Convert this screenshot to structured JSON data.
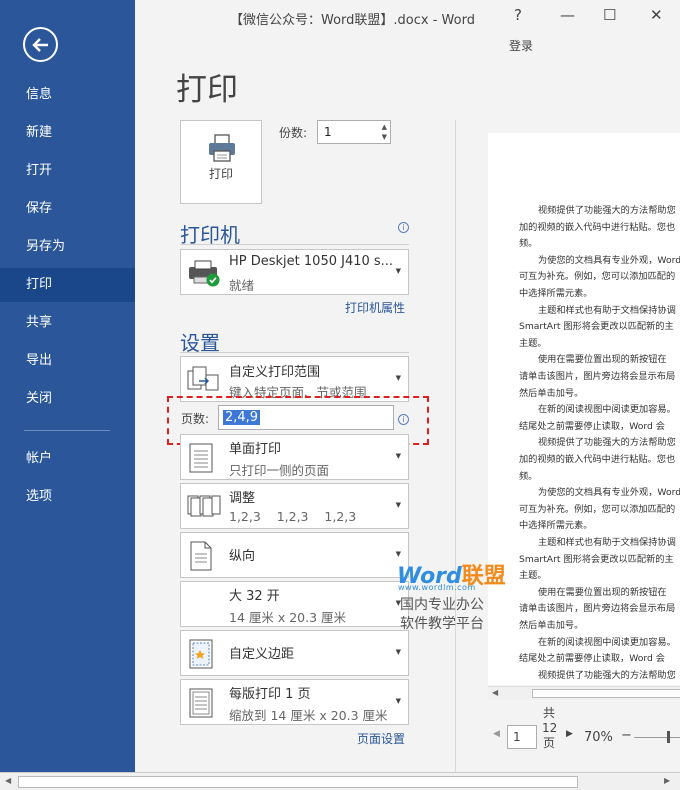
{
  "window": {
    "title": "【微信公众号：Word联盟】.docx - Word",
    "help": "?",
    "minimize": "—",
    "restore": "☐",
    "close": "✕",
    "login": "登录"
  },
  "sidebar": {
    "items": [
      {
        "label": "信息"
      },
      {
        "label": "新建"
      },
      {
        "label": "打开"
      },
      {
        "label": "保存"
      },
      {
        "label": "另存为"
      },
      {
        "label": "打印"
      },
      {
        "label": "共享"
      },
      {
        "label": "导出"
      },
      {
        "label": "关闭"
      },
      {
        "label": "帐户"
      },
      {
        "label": "选项"
      }
    ],
    "active": "打印"
  },
  "print": {
    "title": "打印",
    "button_label": "打印",
    "copies_label": "份数:",
    "copies_value": "1"
  },
  "printer": {
    "heading": "打印机",
    "name": "HP Deskjet 1050 J410 s...",
    "status": "就绪",
    "properties_link": "打印机属性"
  },
  "settings": {
    "heading": "设置",
    "range": {
      "title": "自定义打印范围",
      "sub": "键入特定页面、节或范围"
    },
    "pages_label": "页数:",
    "pages_value": "2,4,9",
    "sides": {
      "title": "单面打印",
      "sub": "只打印一侧的页面"
    },
    "collate": {
      "title": "调整",
      "sub": "1,2,3    1,2,3    1,2,3"
    },
    "orientation": {
      "title": "纵向"
    },
    "paper": {
      "title": "大 32 开",
      "sub": "14 厘米 x 20.3 厘米"
    },
    "margins": {
      "title": "自定义边距"
    },
    "per_page": {
      "title": "每版打印 1 页",
      "sub": "缩放到 14 厘米 x 20.3 厘米"
    },
    "page_setup_link": "页面设置"
  },
  "preview": {
    "lines": [
      "视频提供了功能强大的方法帮助您",
      "加的视频的嵌入代码中进行粘贴。您也",
      "频。",
      "为使您的文档具有专业外观，Word",
      "可互为补充。例如，您可以添加匹配的",
      "中选择所需元素。",
      "主题和样式也有助于文档保持协调",
      "SmartArt 图形将会更改以匹配新的主",
      "主题。",
      "使用在需要位置出现的新按钮在",
      "请单击该图片，图片旁边将会显示布局",
      "然后单击加号。",
      "在新的阅读视图中阅读更加容易。",
      "结尾处之前需要停止读取，Word 会",
      "视频提供了功能强大的方法帮助您",
      "加的视频的嵌入代码中进行粘贴。您也",
      "频。",
      "为使您的文档具有专业外观，Word",
      "可互为补充。例如，您可以添加匹配的",
      "中选择所需元素。",
      "主题和样式也有助于文档保持协调",
      "SmartArt 图形将会更改以匹配新的主",
      "主题。",
      "使用在需要位置出现的新按钮在",
      "请单击该图片，图片旁边将会显示布局",
      "然后单击加号。",
      "在新的阅读视图中阅读更加容易。",
      "结尾处之前需要停止读取，Word 会",
      "视频提供了功能强大的方法帮助您"
    ],
    "indented": [
      0,
      3,
      6,
      9,
      12,
      14,
      17,
      20,
      23,
      26,
      28
    ],
    "page_current": "1",
    "page_total_prefix": "共",
    "page_total": "12",
    "page_total_suffix": "页",
    "zoom": "70%"
  },
  "watermark": {
    "brand_a": "Word",
    "brand_b": "联盟",
    "url": "www.wordlm.com",
    "line1": "国内专业办公",
    "line2": "软件教学平台"
  }
}
